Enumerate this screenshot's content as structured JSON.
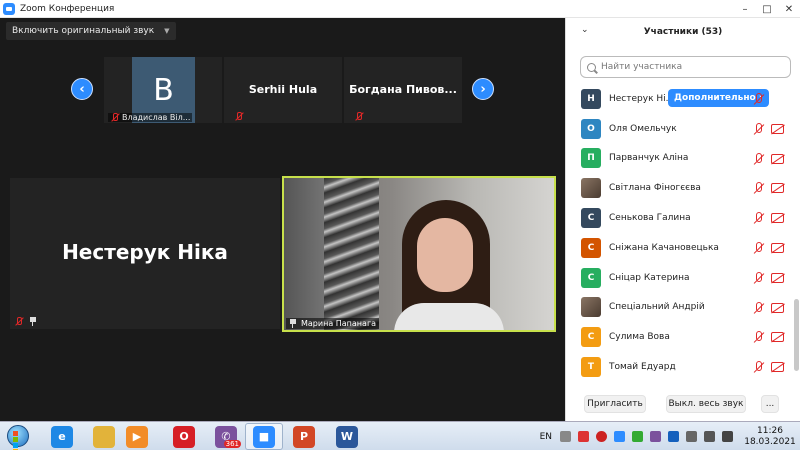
{
  "window": {
    "title": "Zoom Конференция",
    "controls": [
      "–",
      "□",
      "✕"
    ]
  },
  "video": {
    "original_sound_button": "Включить оригинальный звук",
    "strip": [
      {
        "type": "avatar",
        "avatar_letter": "В",
        "label": "Владислав Віл..."
      },
      {
        "type": "name",
        "name": "Serhii Hula"
      },
      {
        "type": "name",
        "name": "Богдана  Пивов..."
      }
    ],
    "main_tile_name": "Нестерук Ніка",
    "active_speaker_label": "Марина Папанага"
  },
  "participants": {
    "title": "Участники (53)",
    "search_placeholder": "Найти участника",
    "more_button": "Дополнительно ›",
    "items": [
      {
        "initial": "Н",
        "name": "Нестерук Ні...",
        "color": "#34495e",
        "host": true
      },
      {
        "initial": "О",
        "name": "Оля Омельчук",
        "color": "#2e86c1"
      },
      {
        "initial": "П",
        "name": "Парванчук Аліна",
        "color": "#27ae60"
      },
      {
        "initial": "",
        "name": "Світлана Фіногєєва",
        "color": "#7a6656",
        "photo": true
      },
      {
        "initial": "С",
        "name": "Сенькова Галина",
        "color": "#34495e"
      },
      {
        "initial": "С",
        "name": "Сніжана Качановецька",
        "color": "#d35400"
      },
      {
        "initial": "С",
        "name": "Сніцар Катерина",
        "color": "#27ae60"
      },
      {
        "initial": "",
        "name": "Спеціальний Андрій",
        "color": "#4a3b30",
        "photo": true
      },
      {
        "initial": "С",
        "name": "Сулима Вова",
        "color": "#f39c12"
      },
      {
        "initial": "Т",
        "name": "Томай Едуард",
        "color": "#f39c12"
      }
    ],
    "footer": {
      "invite": "Пригласить",
      "mute_all": "Выкл. весь звук",
      "more": "..."
    }
  },
  "taskbar": {
    "apps": [
      {
        "name": "ie",
        "color": "#1e88e5",
        "glyph": "e"
      },
      {
        "name": "explorer",
        "color": "#e2b33a",
        "glyph": ""
      },
      {
        "name": "media-player",
        "color": "#f28c28",
        "glyph": "▶"
      },
      {
        "name": "opera",
        "color": "#d61f26",
        "glyph": "O"
      },
      {
        "name": "viber",
        "color": "#7b519d",
        "glyph": "✆",
        "badge": "361"
      },
      {
        "name": "zoom",
        "color": "#2d8cff",
        "glyph": "■"
      },
      {
        "name": "powerpoint",
        "color": "#d24726",
        "glyph": "P"
      },
      {
        "name": "word",
        "color": "#2b579a",
        "glyph": "W"
      }
    ],
    "language": "EN",
    "time": "11:26",
    "date": "18.03.2021"
  }
}
